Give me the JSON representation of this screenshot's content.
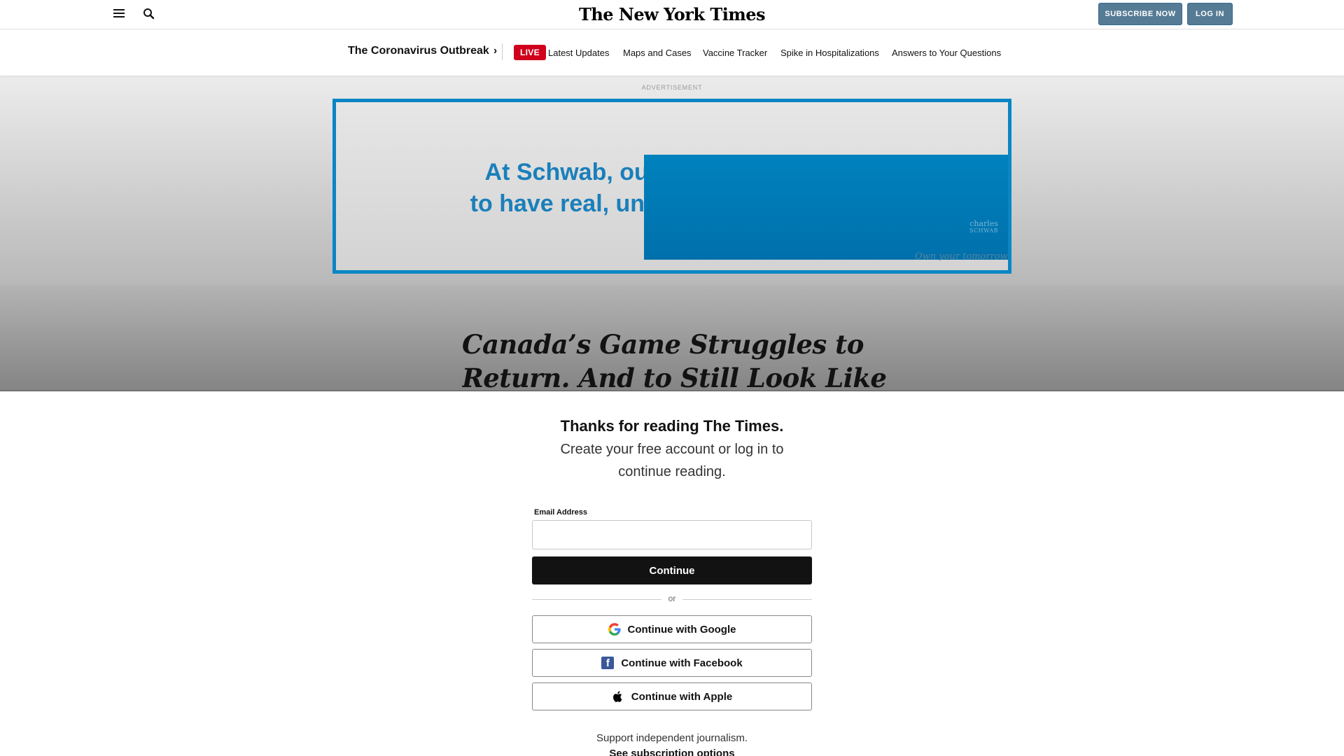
{
  "header": {
    "menu_icon": "hamburger-menu-icon",
    "search_icon": "search-icon",
    "logo": "The New York Times",
    "subscribe_label": "SUBSCRIBE NOW",
    "login_label": "LOG IN"
  },
  "covid_nav": {
    "title": "The Coronavirus Outbreak",
    "live_label": "LIVE",
    "links": [
      "Latest Updates",
      "Maps and Cases",
      "Vaccine Tracker",
      "Spike in Hospitalizations",
      "Answers to Your Questions"
    ]
  },
  "ad": {
    "label": "ADVERTISEMENT",
    "headline_line1": "At Schwab, our",
    "headline_line2": "to have real, uns",
    "brand_line1": "charles",
    "brand_line2": "SCHWAB",
    "tagline": "Own your tomorrow",
    "border_color": "#0a86c4",
    "accent_color": "#0082be"
  },
  "article": {
    "headline": "Canada’s Game Struggles to Return. And to Still Look Like Hockey."
  },
  "regwall": {
    "title": "Thanks for reading The Times.",
    "subtitle": "Create your free account or log in to continue reading.",
    "email_label": "Email Address",
    "email_value": "",
    "continue_label": "Continue",
    "or_label": "or",
    "google_label": "Continue with Google",
    "facebook_label": "Continue with Facebook",
    "apple_label": "Continue with Apple",
    "support_text": "Support independent journalism.",
    "subscription_link": "See subscription options"
  }
}
